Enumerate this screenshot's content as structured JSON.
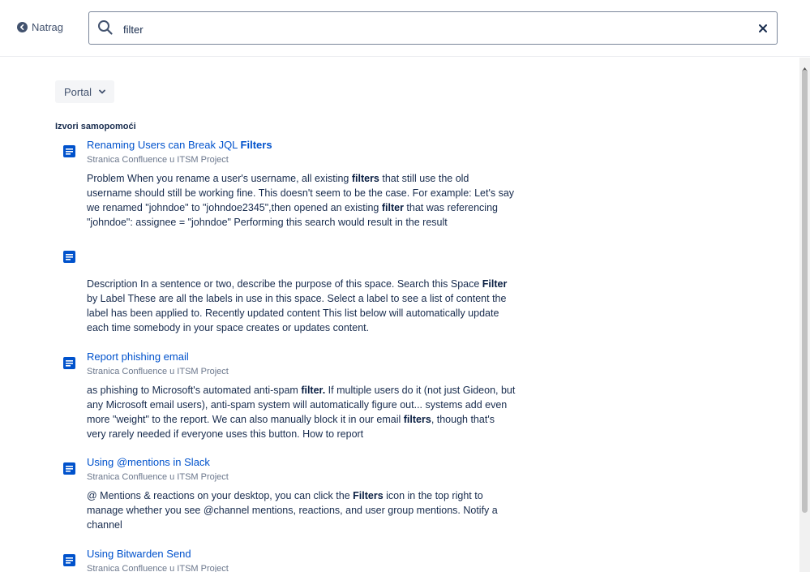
{
  "header": {
    "back_label": "Natrag",
    "search_value": "filter"
  },
  "filter": {
    "portal_label": "Portal"
  },
  "section": {
    "title": "Izvori samopomoći"
  },
  "results": [
    {
      "title_pre": "Renaming Users can Break JQL ",
      "title_bold": "Filters",
      "subtitle": "Stranica Confluence u ITSM Project",
      "body": [
        {
          "t": "Problem When you rename a user's username, all existing "
        },
        {
          "t": "filters",
          "b": true
        },
        {
          "t": " that still use the old username should still be working fine. This doesn't seem to be the case. For example: Let's say we renamed \"johndoe\" to \"johndoe2345\",then  opened an existing "
        },
        {
          "t": "filter",
          "b": true
        },
        {
          "t": " that was referencing \"johndoe\": assignee = \"johndoe\" Performing this search would result in the result"
        }
      ]
    },
    {
      "title_pre": "",
      "title_bold": "",
      "subtitle": "",
      "body": [
        {
          "t": "Description In a sentence or two, describe the purpose of this space. Search this Space "
        },
        {
          "t": "Filter",
          "b": true
        },
        {
          "t": " by Label These are all the labels in use in this space. Select a label to see a list of content the label has been applied to. Recently updated content This list below will automatically update each time somebody in your space creates or updates content."
        }
      ]
    },
    {
      "title_pre": "Report phishing email",
      "title_bold": "",
      "subtitle": "Stranica Confluence u ITSM Project",
      "body": [
        {
          "t": "as phishing to Microsoft's automated anti-spam "
        },
        {
          "t": "filter.",
          "b": true
        },
        {
          "t": " If multiple users do it (not just Gideon, but any Microsoft email users), anti-spam system will automatically figure out... systems add even more \"weight\" to the report. We can also manually block it in our email "
        },
        {
          "t": "filters",
          "b": true
        },
        {
          "t": ", though that's very rarely needed if everyone uses this button. How to report"
        }
      ]
    },
    {
      "title_pre": "Using @mentions in Slack",
      "title_bold": "",
      "subtitle": "Stranica Confluence u ITSM Project",
      "body": [
        {
          "t": "@ Mentions & reactions on your desktop, you can click the "
        },
        {
          "t": "Filters",
          "b": true
        },
        {
          "t": " icon in the top right to manage whether you see @channel mentions, reactions, and user group mentions. Notify a channel"
        }
      ]
    },
    {
      "title_pre": "Using Bitwarden Send",
      "title_bold": "",
      "subtitle": "Stranica Confluence u ITSM Project",
      "body": []
    }
  ],
  "colors": {
    "link": "#0052cc",
    "icon": "#0052cc",
    "text": "#172b4d",
    "muted": "#6b778c"
  },
  "icons": [
    "arrow-left-circle-icon",
    "search-icon",
    "close-icon",
    "chevron-down-icon",
    "document-icon"
  ]
}
